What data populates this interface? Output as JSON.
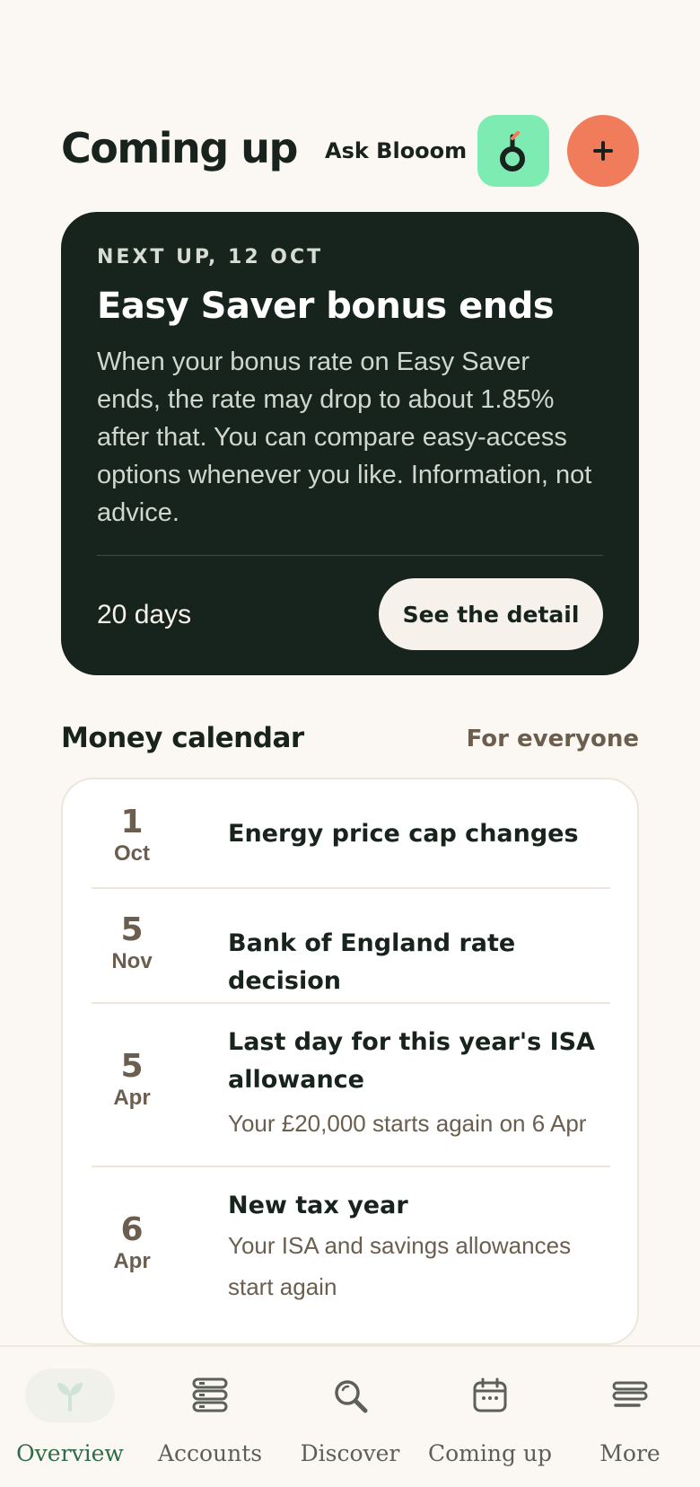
{
  "header": {
    "title": "Coming up",
    "ask_label": "Ask Blooom",
    "blooom_icon": "blooom-logo-icon",
    "add_icon": "plus-icon"
  },
  "next_up": {
    "eyebrow": "NEXT UP, 12 OCT",
    "title": "Easy Saver bonus ends",
    "body": "When your bonus rate on Easy Saver ends, the rate may drop to about 1.85% after that. You can compare easy-access options whenever you like. Information, not advice.",
    "countdown": "20 days",
    "cta_label": "See the detail"
  },
  "money_calendar": {
    "title": "Money calendar",
    "filter_label": "For everyone",
    "events": [
      {
        "day": "1",
        "month": "Oct",
        "title": "Energy price cap changes",
        "subtitle": ""
      },
      {
        "day": "5",
        "month": "Nov",
        "title": "Bank of England rate decision",
        "subtitle": ""
      },
      {
        "day": "5",
        "month": "Apr",
        "title": "Last day for this year's ISA allowance",
        "subtitle": "Your £20,000 starts again on 6 Apr"
      },
      {
        "day": "6",
        "month": "Apr",
        "title": "New tax year",
        "subtitle": "Your ISA and savings allowances start again"
      }
    ]
  },
  "nav": {
    "items": [
      {
        "label": "Overview",
        "icon": "sprout-icon",
        "active": true
      },
      {
        "label": "Accounts",
        "icon": "stacked-accounts-icon",
        "active": false
      },
      {
        "label": "Discover",
        "icon": "magnifier-icon",
        "active": false
      },
      {
        "label": "Coming up",
        "icon": "calendar-icon",
        "active": false
      },
      {
        "label": "More",
        "icon": "menu-lines-icon",
        "active": false
      }
    ]
  },
  "colors": {
    "background": "#FBF8F3",
    "ink": "#18231D",
    "card_dark": "#17241E",
    "mint": "#7EEBB3",
    "coral": "#F07C5C",
    "muted_brown": "#6B5E4E",
    "active_nav": "#2F6B47"
  }
}
